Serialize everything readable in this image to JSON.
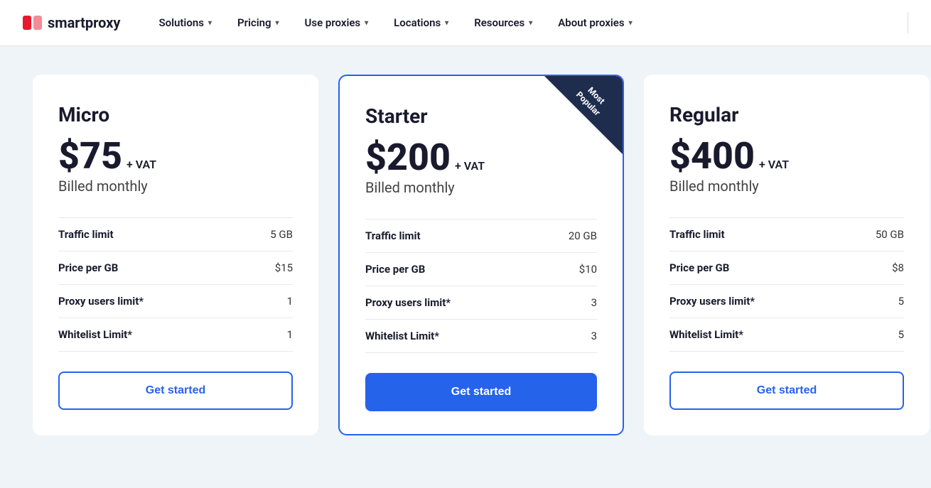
{
  "brand": {
    "name": "smartproxy",
    "logo_alt": "Smartproxy logo"
  },
  "navbar": {
    "items": [
      {
        "label": "Solutions",
        "has_dropdown": true
      },
      {
        "label": "Pricing",
        "has_dropdown": true
      },
      {
        "label": "Use proxies",
        "has_dropdown": true
      },
      {
        "label": "Locations",
        "has_dropdown": true
      },
      {
        "label": "Resources",
        "has_dropdown": true
      },
      {
        "label": "About proxies",
        "has_dropdown": true
      }
    ]
  },
  "pricing": {
    "plans": [
      {
        "id": "micro",
        "name": "Micro",
        "price": "$75",
        "vat": "+ VAT",
        "billing": "Billed monthly",
        "featured": false,
        "badge": null,
        "features": [
          {
            "label": "Traffic limit",
            "value": "5 GB"
          },
          {
            "label": "Price per GB",
            "value": "$15"
          },
          {
            "label": "Proxy users limit*",
            "value": "1"
          },
          {
            "label": "Whitelist Limit*",
            "value": "1"
          }
        ],
        "cta_label": "Get started",
        "cta_style": "outline"
      },
      {
        "id": "starter",
        "name": "Starter",
        "price": "$200",
        "vat": "+ VAT",
        "billing": "Billed monthly",
        "featured": true,
        "badge": "Most Popular",
        "features": [
          {
            "label": "Traffic limit",
            "value": "20 GB"
          },
          {
            "label": "Price per GB",
            "value": "$10"
          },
          {
            "label": "Proxy users limit*",
            "value": "3"
          },
          {
            "label": "Whitelist Limit*",
            "value": "3"
          }
        ],
        "cta_label": "Get started",
        "cta_style": "filled"
      },
      {
        "id": "regular",
        "name": "Regular",
        "price": "$400",
        "vat": "+ VAT",
        "billing": "Billed monthly",
        "featured": false,
        "badge": null,
        "features": [
          {
            "label": "Traffic limit",
            "value": "50 GB"
          },
          {
            "label": "Price per GB",
            "value": "$8"
          },
          {
            "label": "Proxy users limit*",
            "value": "5"
          },
          {
            "label": "Whitelist Limit*",
            "value": "5"
          }
        ],
        "cta_label": "Get started",
        "cta_style": "outline"
      }
    ]
  }
}
